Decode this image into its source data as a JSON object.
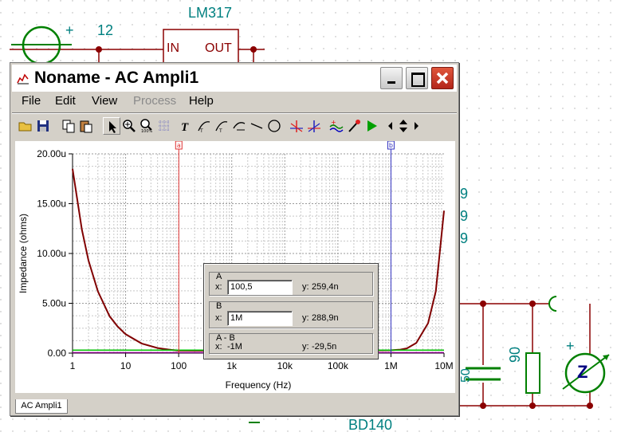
{
  "schematic": {
    "regulator_label": "LM317",
    "pin_in": "IN",
    "pin_out": "OUT",
    "plus_sign": "+",
    "node_number": "12",
    "transistor_label": "BD140",
    "resistor_value": "90",
    "cap_partial": "50",
    "partial_digits": [
      "9",
      "9",
      "9"
    ],
    "impedance_meter": "Z",
    "minus_sign": "—",
    "wire_color": "#8b0000",
    "component_color": "#008000"
  },
  "window": {
    "title": "Noname - AC Ampli1",
    "buttons": {
      "minimize": "minimize",
      "maximize": "maximize",
      "close": "close"
    }
  },
  "menu": [
    "File",
    "Edit",
    "View",
    "Process",
    "Help"
  ],
  "menu_disabled": [
    "Process"
  ],
  "toolbar": [
    "open-folder-icon",
    "save-disk-icon",
    "copy-icon",
    "paste-icon",
    "pointer-icon",
    "zoom-in-icon",
    "zoom-100-icon",
    "grid-icon",
    "text-tool-icon",
    "curve-label-icon",
    "curve-label2-icon",
    "curve-label3-icon",
    "line-tool-icon",
    "circle-tool-icon",
    "cursor-a-icon",
    "cursor-b-icon",
    "add-curve-icon",
    "probe-icon",
    "run-icon",
    "nav-left-icon",
    "nav-updown-icon",
    "nav-right-icon"
  ],
  "cursor_dialog": {
    "a": {
      "title": "A",
      "x_label": "x:",
      "x_value": "100,5",
      "y_label": "y:",
      "y_value": "259,4n"
    },
    "b": {
      "title": "B",
      "x_label": "x:",
      "x_value": "1M",
      "y_label": "y:",
      "y_value": "288,9n"
    },
    "diff": {
      "title": "A - B",
      "x_label": "x:",
      "x_value": "-1M",
      "y_label": "y:",
      "y_value": "-29,5n"
    }
  },
  "tab": "AC Ampli1",
  "chart_data": {
    "type": "line",
    "xlabel": "Frequency (Hz)",
    "ylabel": "Impedance (ohms)",
    "x_scale": "log",
    "xlim": [
      1,
      10000000
    ],
    "ylim": [
      0,
      2e-05
    ],
    "x_ticks": [
      {
        "value": 1,
        "label": "1"
      },
      {
        "value": 10,
        "label": "10"
      },
      {
        "value": 100,
        "label": "100"
      },
      {
        "value": 1000,
        "label": "1k"
      },
      {
        "value": 10000,
        "label": "10k"
      },
      {
        "value": 100000,
        "label": "100k"
      },
      {
        "value": 1000000,
        "label": "1M"
      },
      {
        "value": 10000000,
        "label": "10M"
      }
    ],
    "y_ticks": [
      {
        "value": 0,
        "label": "0.00"
      },
      {
        "value": 5e-06,
        "label": "5.00u"
      },
      {
        "value": 1e-05,
        "label": "10.00u"
      },
      {
        "value": 1.5e-05,
        "label": "15.00u"
      },
      {
        "value": 2e-05,
        "label": "20.00u"
      }
    ],
    "grid": true,
    "series": [
      {
        "color": "#800000",
        "x": [
          1,
          1.5,
          2,
          3,
          5,
          7,
          10,
          20,
          40,
          70,
          100,
          1000,
          10000,
          100000,
          1000000,
          1500000,
          2000000,
          3000000,
          5000000,
          7000000,
          10000000
        ],
        "y": [
          1.85e-05,
          1.24e-05,
          9.3e-06,
          6.2e-06,
          3.7e-06,
          2.7e-06,
          1.9e-06,
          9.7e-07,
          5.1e-07,
          3.3e-07,
          2.6e-07,
          2.5e-07,
          2.5e-07,
          2.5e-07,
          2.9e-07,
          3.5e-07,
          4.8e-07,
          1.02e-06,
          3e-06,
          6.2e-06,
          1.43e-05
        ]
      },
      {
        "color": "#00c000",
        "x": [
          1,
          10000000
        ],
        "y": [
          3e-07,
          3e-07
        ]
      },
      {
        "color": "#800080",
        "x": [
          1,
          10000000
        ],
        "y": [
          5e-08,
          5e-08
        ]
      }
    ],
    "cursors": [
      {
        "label": "a",
        "x": 100.5,
        "color": "#e03030"
      },
      {
        "label": "b",
        "x": 1000000,
        "color": "#3030c0"
      }
    ]
  }
}
